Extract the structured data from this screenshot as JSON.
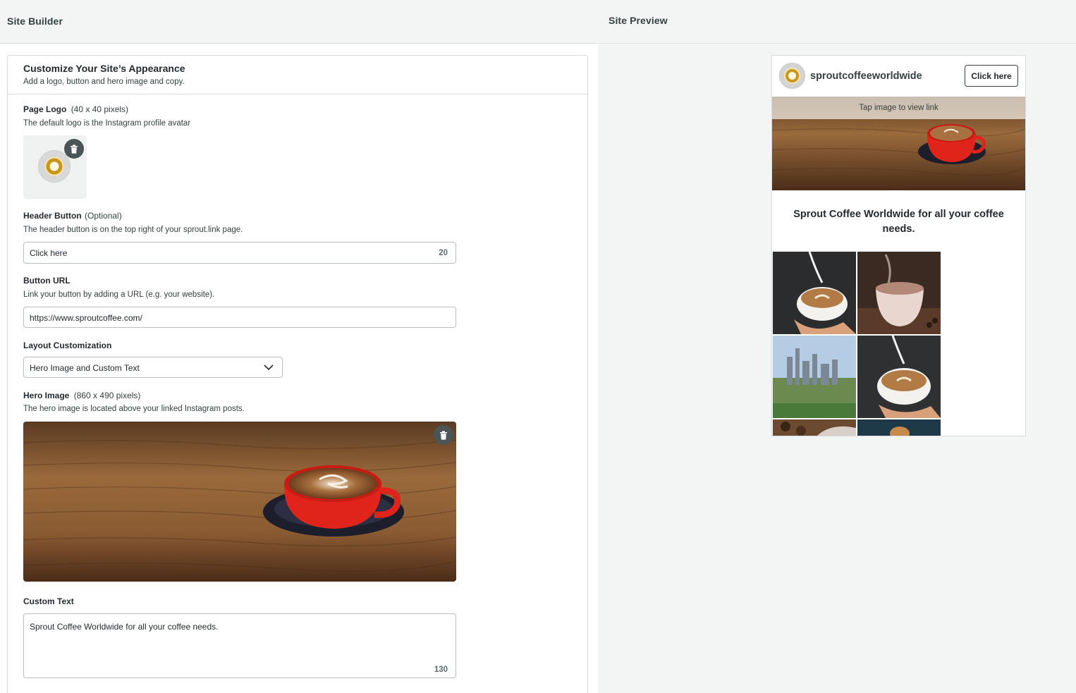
{
  "header": {
    "builder_title": "Site Builder",
    "preview_title": "Site Preview"
  },
  "card": {
    "title": "Customize Your Site’s Appearance",
    "subtitle": "Add a logo, button and hero image and copy."
  },
  "logo_section": {
    "label": "Page Logo",
    "size_hint": "(40 x 40 pixels)",
    "help": "The default logo is the Instagram profile avatar"
  },
  "header_button": {
    "label": "Header Button",
    "optional_hint": "(Optional)",
    "help": "The header button is on the top right of your sprout.link page.",
    "value": "Click here",
    "char_count": "20"
  },
  "button_url": {
    "label": "Button URL",
    "help": "Link your button by adding a URL (e.g. your website).",
    "value": "https://www.sproutcoffee.com/"
  },
  "layout": {
    "label": "Layout Customization",
    "selected": "Hero Image and Custom Text"
  },
  "hero_section": {
    "label": "Hero Image",
    "size_hint": "(860 x 490 pixels)",
    "help": "The hero image is located above your linked Instagram posts."
  },
  "custom_text": {
    "label": "Custom Text",
    "value": "Sprout Coffee Worldwide for all your coffee needs.",
    "char_count": "130"
  },
  "preview": {
    "username": "sproutcoffeeworldwide",
    "button_label": "Click here",
    "tap_hint": "Tap image to view link",
    "custom_text": "Sprout Coffee Worldwide for all your coffee needs."
  },
  "icons": {
    "delete": "trash-icon",
    "dropdown": "chevron-down-icon"
  },
  "colors": {
    "text_primary": "#242a2e",
    "text_secondary": "#364141",
    "border": "#b9bfc1",
    "trash_bg": "#4b5557",
    "cup_red": "#e0241c"
  }
}
